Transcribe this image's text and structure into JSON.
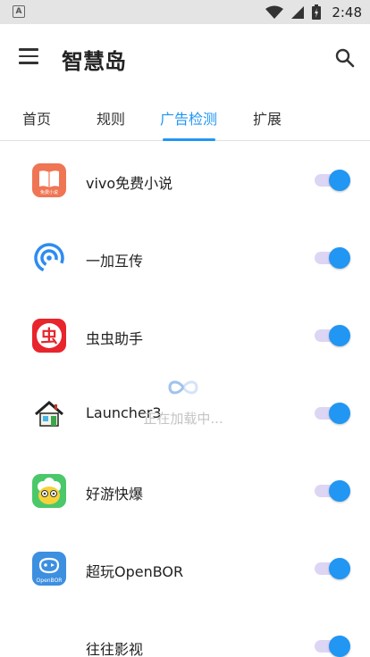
{
  "status_bar": {
    "left_badge": "A",
    "time": "2:48",
    "icons": [
      "wifi-icon",
      "signal-icon",
      "battery-icon"
    ]
  },
  "app_bar": {
    "title": "智慧岛",
    "menu_icon": "menu-icon",
    "search_icon": "search-icon"
  },
  "tabs": [
    {
      "label": "首页",
      "active": false
    },
    {
      "label": "规则",
      "active": false
    },
    {
      "label": "广告检测",
      "active": true
    },
    {
      "label": "扩展",
      "active": false
    }
  ],
  "apps": [
    {
      "name": "vivo免费小说",
      "icon": "vivo-novel-icon",
      "icon_text": "免费小说",
      "enabled": true
    },
    {
      "name": "一加互传",
      "icon": "oneplus-share-icon",
      "enabled": true
    },
    {
      "name": "虫虫助手",
      "icon": "chongchong-icon",
      "icon_text": "虫",
      "enabled": true
    },
    {
      "name": "Launcher3",
      "icon": "launcher-house-icon",
      "enabled": true
    },
    {
      "name": "好游快爆",
      "icon": "haoyou-icon",
      "enabled": true
    },
    {
      "name": "超玩OpenBOR",
      "icon": "openbor-icon",
      "icon_text": "OpenBOR",
      "enabled": true
    },
    {
      "name": "往往影视",
      "icon": "",
      "enabled": true
    }
  ],
  "loading": {
    "text": "正在加载中...",
    "icon": "infinity-spinner-icon"
  },
  "colors": {
    "accent": "#2196f3",
    "switch_track": "#ddd5f4",
    "status_bar": "#e4e4e4"
  }
}
